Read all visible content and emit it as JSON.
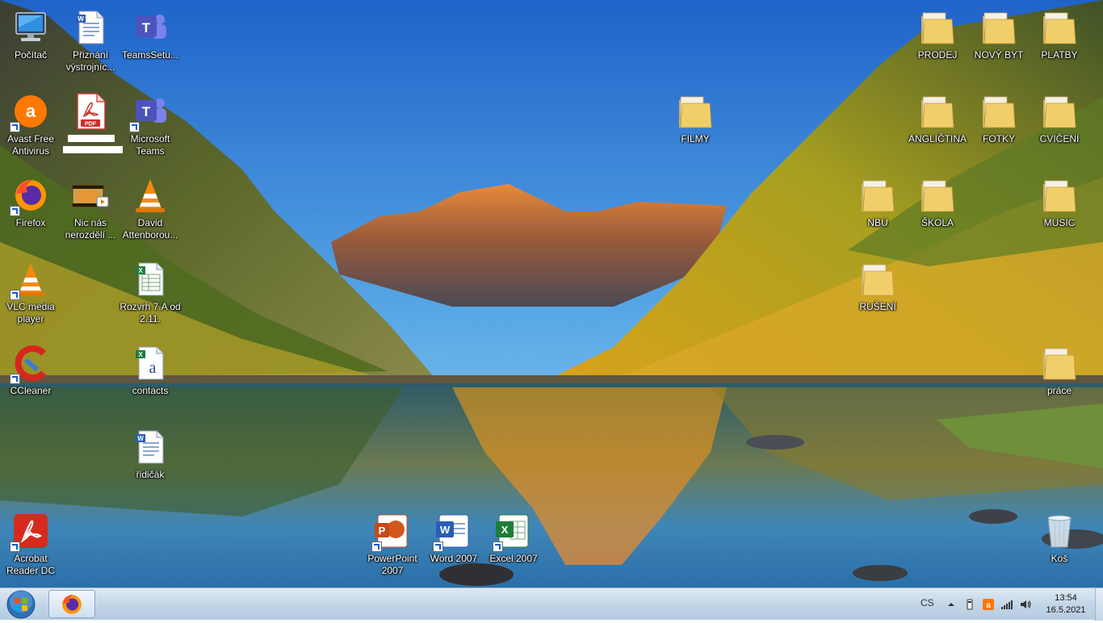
{
  "desktop": {
    "icons": [
      {
        "id": "pocitac",
        "label": "Počítač",
        "icon": "computer-icon"
      },
      {
        "id": "priznani",
        "label": "Přiznání výstrojníc...",
        "icon": "word-document-icon"
      },
      {
        "id": "teamssetup",
        "label": "TeamsSetu...",
        "icon": "teams-icon"
      },
      {
        "id": "avast",
        "label": "Avast Free Antivirus",
        "icon": "avast-icon"
      },
      {
        "id": "pdf",
        "label": "",
        "icon": "pdf-icon"
      },
      {
        "id": "msteams",
        "label": "Microsoft Teams",
        "icon": "teams-icon"
      },
      {
        "id": "firefox",
        "label": "Firefox",
        "icon": "firefox-icon"
      },
      {
        "id": "nicnas",
        "label": "Nic nás nerozdělí ...",
        "icon": "video-icon"
      },
      {
        "id": "david",
        "label": "David Attenborou...",
        "icon": "vlc-icon"
      },
      {
        "id": "vlc",
        "label": "VLC media player",
        "icon": "vlc-icon"
      },
      {
        "id": "rozvrh",
        "label": "Rozvrh 7.A od 2.11.",
        "icon": "excel-document-icon"
      },
      {
        "id": "ccleaner",
        "label": "CCleaner",
        "icon": "ccleaner-icon"
      },
      {
        "id": "contacts",
        "label": "contacts",
        "icon": "excel-csv-icon"
      },
      {
        "id": "ridicak",
        "label": "řidičák",
        "icon": "word-document-icon"
      },
      {
        "id": "acrobat",
        "label": "Acrobat Reader DC",
        "icon": "acrobat-icon"
      },
      {
        "id": "powerpoint",
        "label": "PowerPoint 2007",
        "icon": "powerpoint-icon"
      },
      {
        "id": "word",
        "label": "Word 2007",
        "icon": "word-icon"
      },
      {
        "id": "excel",
        "label": "Excel 2007",
        "icon": "excel-icon"
      },
      {
        "id": "filmy",
        "label": "FILMY",
        "icon": "folder-icon"
      },
      {
        "id": "prodej",
        "label": "PRODEJ",
        "icon": "folder-icon"
      },
      {
        "id": "novybyt",
        "label": "NOVÝ BYT",
        "icon": "folder-icon"
      },
      {
        "id": "platby",
        "label": "PLATBY",
        "icon": "folder-icon"
      },
      {
        "id": "anglictina",
        "label": "ANGLIČTINA",
        "icon": "folder-icon"
      },
      {
        "id": "fotky",
        "label": "FOTKY",
        "icon": "folder-icon"
      },
      {
        "id": "cviceni",
        "label": "CVIČENÍ",
        "icon": "folder-icon"
      },
      {
        "id": "nbu",
        "label": "NBÚ",
        "icon": "folder-icon"
      },
      {
        "id": "skola",
        "label": "ŠKOLA",
        "icon": "folder-icon"
      },
      {
        "id": "music",
        "label": "MUSIC",
        "icon": "folder-icon"
      },
      {
        "id": "ruseni",
        "label": "RUŠENÍ",
        "icon": "folder-icon"
      },
      {
        "id": "prace",
        "label": "práce",
        "icon": "folder-icon"
      },
      {
        "id": "kos",
        "label": "Koš",
        "icon": "recycle-bin-icon"
      }
    ]
  },
  "taskbar": {
    "start_icon": "windows-start-icon",
    "pinned_app": "firefox-icon",
    "tray": {
      "language": "CS",
      "time": "13:54",
      "date": "16.5.2021"
    }
  },
  "colors": {
    "taskbar_top": "#dde9f3",
    "taskbar_bottom": "#b6cbe0",
    "sky_top": "#1f63c9",
    "sky_bottom": "#9fd2ef"
  }
}
